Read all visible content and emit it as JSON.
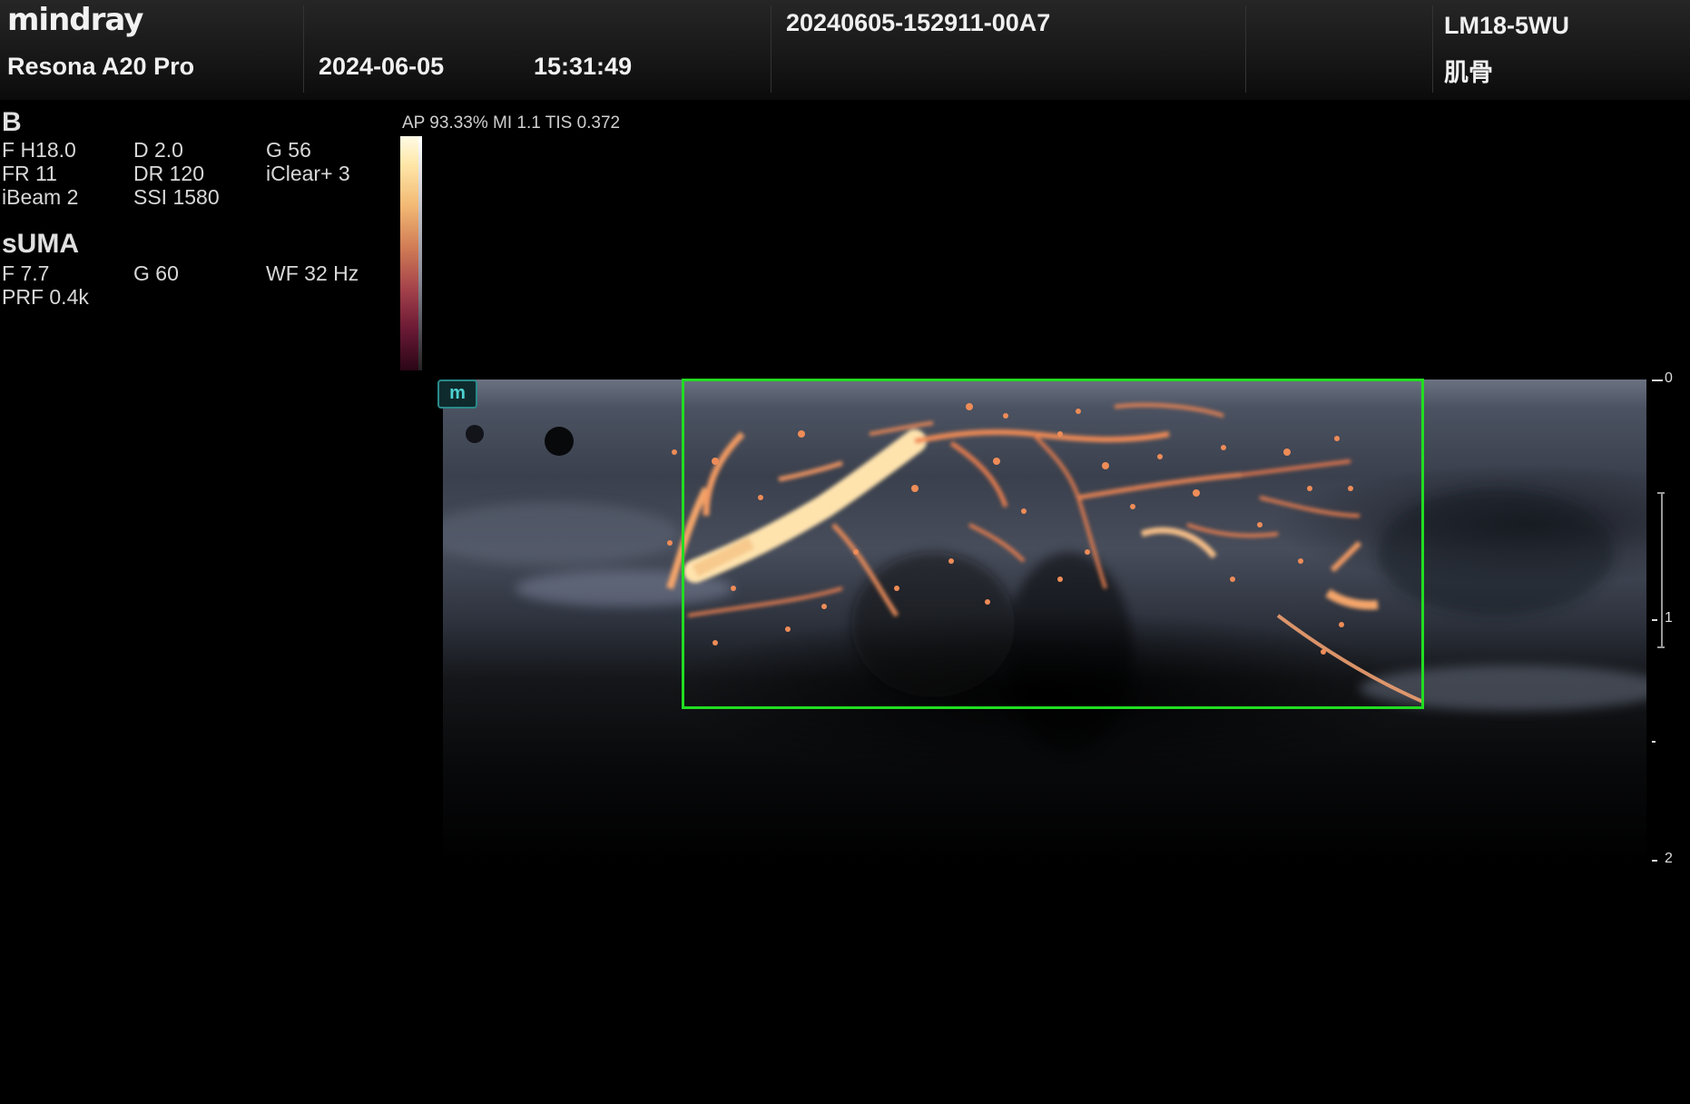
{
  "header": {
    "brand": "mindray",
    "model": "Resona A20 Pro",
    "date": "2024-06-05",
    "time": "15:31:49",
    "exam_id": "20240605-152911-00A7",
    "probe": "LM18-5WU",
    "preset": "肌骨"
  },
  "b_mode": {
    "label": "B",
    "params": [
      [
        "F H18.0",
        "D 2.0",
        "G 56"
      ],
      [
        "FR 11",
        "DR 120",
        "iClear+ 3"
      ],
      [
        "iBeam 2",
        "SSI 1580",
        ""
      ]
    ]
  },
  "suma_mode": {
    "label": "sUMA",
    "params": [
      [
        "F 7.7",
        "G 60",
        "WF 32 Hz"
      ],
      [
        "PRF 0.4k",
        "",
        ""
      ]
    ]
  },
  "acoustic": "AP 93.33%  MI 1.1 TIS 0.372",
  "badge": "m",
  "depth_scale": {
    "labels": [
      "0",
      "1",
      "2"
    ]
  },
  "colors": {
    "roi_box": "#22dd22",
    "badge": "#4ed2d2"
  }
}
